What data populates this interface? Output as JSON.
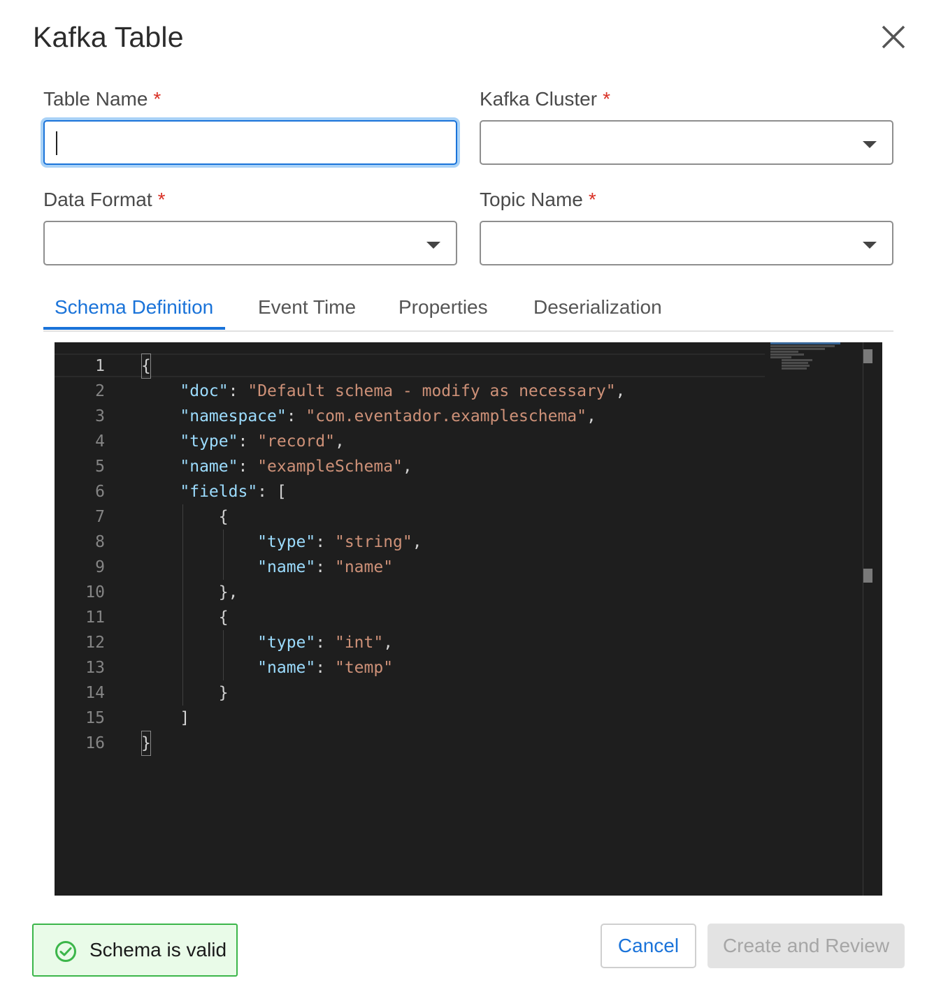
{
  "dialog": {
    "title": "Kafka Table"
  },
  "form": {
    "table_name_label": "Table Name",
    "kafka_cluster_label": "Kafka Cluster",
    "data_format_label": "Data Format",
    "topic_name_label": "Topic Name",
    "required_marker": "*",
    "table_name_value": "",
    "kafka_cluster_value": "",
    "data_format_value": "",
    "topic_name_value": ""
  },
  "tabs": [
    {
      "label": "Schema Definition",
      "active": true
    },
    {
      "label": "Event Time",
      "active": false
    },
    {
      "label": "Properties",
      "active": false
    },
    {
      "label": "Deserialization",
      "active": false
    }
  ],
  "editor": {
    "line_numbers": [
      "1",
      "2",
      "3",
      "4",
      "5",
      "6",
      "7",
      "8",
      "9",
      "10",
      "11",
      "12",
      "13",
      "14",
      "15",
      "16"
    ],
    "lines": [
      "{",
      "    \"doc\": \"Default schema - modify as necessary\",",
      "    \"namespace\": \"com.eventador.exampleschema\",",
      "    \"type\": \"record\",",
      "    \"name\": \"exampleSchema\",",
      "    \"fields\": [",
      "        {",
      "            \"type\": \"string\",",
      "            \"name\": \"name\"",
      "        },",
      "        {",
      "            \"type\": \"int\",",
      "            \"name\": \"temp\"",
      "        }",
      "    ]",
      "}"
    ]
  },
  "footer": {
    "status_text": "Schema is valid",
    "cancel_label": "Cancel",
    "create_label": "Create and Review"
  },
  "colors": {
    "accent": "#1a73d9",
    "valid_border": "#3cb64a",
    "valid_bg": "#e9fbe8",
    "editor_bg": "#1e1e1e",
    "json_key": "#9cdcfe",
    "json_string": "#ce9178",
    "required": "#d93025"
  }
}
